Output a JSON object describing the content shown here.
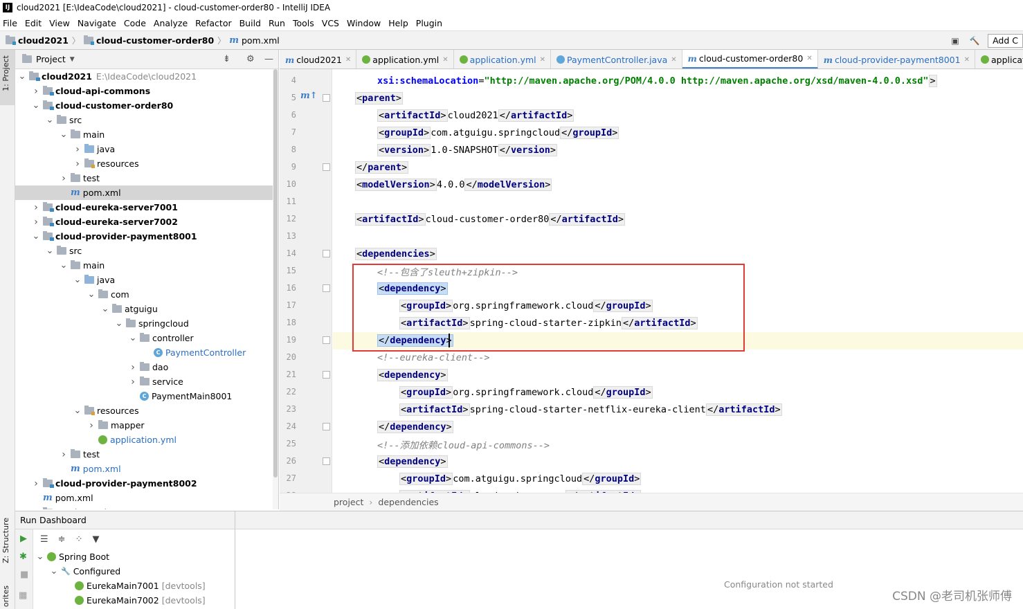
{
  "window": {
    "title": "cloud2021 [E:\\IdeaCode\\cloud2021] - cloud-customer-order80 - IntelliJ IDEA",
    "logo": "IJ"
  },
  "menu": [
    "File",
    "Edit",
    "View",
    "Navigate",
    "Code",
    "Analyze",
    "Refactor",
    "Build",
    "Run",
    "Tools",
    "VCS",
    "Window",
    "Help",
    "Plugin"
  ],
  "navbar": {
    "crumbs": [
      "cloud2021",
      "cloud-customer-order80",
      "pom.xml"
    ],
    "add_label": "Add C"
  },
  "left_stripe": {
    "project_tab": "1: Project",
    "structure_tab": "Z: Structure",
    "favorites_tab": "orites"
  },
  "project_panel": {
    "title": "Project",
    "tree": [
      {
        "label": "cloud2021",
        "extra": "E:\\IdeaCode\\cloud2021",
        "bold": true,
        "depth": 0,
        "arrow": "down",
        "icon": "module"
      },
      {
        "label": "cloud-api-commons",
        "bold": true,
        "depth": 1,
        "arrow": "right",
        "icon": "module"
      },
      {
        "label": "cloud-customer-order80",
        "bold": true,
        "depth": 1,
        "arrow": "down",
        "icon": "module"
      },
      {
        "label": "src",
        "depth": 2,
        "arrow": "down",
        "icon": "folder"
      },
      {
        "label": "main",
        "depth": 3,
        "arrow": "down",
        "icon": "folder"
      },
      {
        "label": "java",
        "depth": 4,
        "arrow": "right",
        "icon": "src"
      },
      {
        "label": "resources",
        "depth": 4,
        "arrow": "right",
        "icon": "res"
      },
      {
        "label": "test",
        "depth": 3,
        "arrow": "right",
        "icon": "folder"
      },
      {
        "label": "pom.xml",
        "depth": 3,
        "arrow": "none",
        "icon": "maven",
        "selected": true
      },
      {
        "label": "cloud-eureka-server7001",
        "bold": true,
        "depth": 1,
        "arrow": "right",
        "icon": "module"
      },
      {
        "label": "cloud-eureka-server7002",
        "bold": true,
        "depth": 1,
        "arrow": "right",
        "icon": "module"
      },
      {
        "label": "cloud-provider-payment8001",
        "bold": true,
        "depth": 1,
        "arrow": "down",
        "icon": "module"
      },
      {
        "label": "src",
        "depth": 2,
        "arrow": "down",
        "icon": "folder"
      },
      {
        "label": "main",
        "depth": 3,
        "arrow": "down",
        "icon": "folder"
      },
      {
        "label": "java",
        "depth": 4,
        "arrow": "down",
        "icon": "src"
      },
      {
        "label": "com",
        "depth": 5,
        "arrow": "down",
        "icon": "folder"
      },
      {
        "label": "atguigu",
        "depth": 6,
        "arrow": "down",
        "icon": "folder"
      },
      {
        "label": "springcloud",
        "depth": 7,
        "arrow": "down",
        "icon": "folder"
      },
      {
        "label": "controller",
        "depth": 8,
        "arrow": "down",
        "icon": "folder"
      },
      {
        "label": "PaymentController",
        "depth": 9,
        "arrow": "none",
        "icon": "class",
        "blue": true
      },
      {
        "label": "dao",
        "depth": 8,
        "arrow": "right",
        "icon": "folder"
      },
      {
        "label": "service",
        "depth": 8,
        "arrow": "right",
        "icon": "folder"
      },
      {
        "label": "PaymentMain8001",
        "depth": 8,
        "arrow": "none",
        "icon": "class"
      },
      {
        "label": "resources",
        "depth": 4,
        "arrow": "down",
        "icon": "res"
      },
      {
        "label": "mapper",
        "depth": 5,
        "arrow": "right",
        "icon": "folder"
      },
      {
        "label": "application.yml",
        "depth": 5,
        "arrow": "none",
        "icon": "spring",
        "blue": true
      },
      {
        "label": "test",
        "depth": 3,
        "arrow": "right",
        "icon": "folder"
      },
      {
        "label": "pom.xml",
        "depth": 3,
        "arrow": "none",
        "icon": "maven",
        "blue": true
      },
      {
        "label": "cloud-provider-payment8002",
        "bold": true,
        "depth": 1,
        "arrow": "right",
        "icon": "module"
      },
      {
        "label": "pom.xml",
        "depth": 1,
        "arrow": "none",
        "icon": "maven"
      },
      {
        "label": "ReadMe.md",
        "depth": 1,
        "arrow": "none",
        "icon": "file"
      }
    ]
  },
  "tabs": [
    {
      "label": "cloud2021",
      "icon": "maven"
    },
    {
      "label": "application.yml",
      "icon": "spring"
    },
    {
      "label": "application.yml",
      "icon": "spring",
      "blue": true
    },
    {
      "label": "PaymentController.java",
      "icon": "class",
      "blue": true
    },
    {
      "label": "cloud-customer-order80",
      "icon": "maven",
      "active": true
    },
    {
      "label": "cloud-provider-payment8001",
      "icon": "maven",
      "blue": true
    },
    {
      "label": "application.yml",
      "icon": "spring"
    }
  ],
  "editor": {
    "lines": [
      {
        "n": "4",
        "indent": 2,
        "parts": [
          [
            "attrn",
            "xsi:schemaLocation"
          ],
          [
            "txt",
            "="
          ],
          [
            "attrv",
            "\"http://maven.apache.org/POM/4.0.0 http://maven.apache.org/xsd/maven-4.0.0.xsd\""
          ],
          [
            "tc",
            ">"
          ]
        ]
      },
      {
        "n": "5",
        "indent": 1,
        "parts": [
          [
            "open",
            "parent"
          ]
        ]
      },
      {
        "n": "6",
        "indent": 2,
        "parts": [
          [
            "open",
            "artifactId"
          ],
          [
            "txt",
            "cloud2021"
          ],
          [
            "close",
            "artifactId"
          ]
        ]
      },
      {
        "n": "7",
        "indent": 2,
        "parts": [
          [
            "open",
            "groupId"
          ],
          [
            "txt",
            "com.atguigu.springcloud"
          ],
          [
            "close",
            "groupId"
          ]
        ]
      },
      {
        "n": "8",
        "indent": 2,
        "parts": [
          [
            "open",
            "version"
          ],
          [
            "txt",
            "1.0-SNAPSHOT"
          ],
          [
            "close",
            "version"
          ]
        ]
      },
      {
        "n": "9",
        "indent": 1,
        "parts": [
          [
            "close",
            "parent"
          ]
        ]
      },
      {
        "n": "10",
        "indent": 1,
        "parts": [
          [
            "open",
            "modelVersion"
          ],
          [
            "txt",
            "4.0.0"
          ],
          [
            "close",
            "modelVersion"
          ]
        ]
      },
      {
        "n": "11",
        "indent": 1,
        "parts": []
      },
      {
        "n": "12",
        "indent": 1,
        "parts": [
          [
            "open",
            "artifactId"
          ],
          [
            "txt",
            "cloud-customer-order80"
          ],
          [
            "close",
            "artifactId"
          ]
        ]
      },
      {
        "n": "13",
        "indent": 1,
        "parts": []
      },
      {
        "n": "14",
        "indent": 1,
        "parts": [
          [
            "open",
            "dependencies"
          ]
        ]
      },
      {
        "n": "15",
        "indent": 2,
        "parts": [
          [
            "cm",
            "<!--包含了sleuth+zipkin-->"
          ]
        ]
      },
      {
        "n": "16",
        "indent": 2,
        "parts": [
          [
            "openhl",
            "dependency"
          ]
        ]
      },
      {
        "n": "17",
        "indent": 3,
        "parts": [
          [
            "open",
            "groupId"
          ],
          [
            "txt",
            "org.springframework.cloud"
          ],
          [
            "close",
            "groupId"
          ]
        ]
      },
      {
        "n": "18",
        "indent": 3,
        "parts": [
          [
            "open",
            "artifactId"
          ],
          [
            "txt",
            "spring-cloud-starter-zipkin"
          ],
          [
            "close",
            "artifactId"
          ]
        ]
      },
      {
        "n": "19",
        "indent": 2,
        "parts": [
          [
            "closehl",
            "dependency"
          ]
        ]
      },
      {
        "n": "20",
        "indent": 2,
        "parts": [
          [
            "cm",
            "<!--eureka-client-->"
          ]
        ]
      },
      {
        "n": "21",
        "indent": 2,
        "parts": [
          [
            "open",
            "dependency"
          ]
        ]
      },
      {
        "n": "22",
        "indent": 3,
        "parts": [
          [
            "open",
            "groupId"
          ],
          [
            "txt",
            "org.springframework.cloud"
          ],
          [
            "close",
            "groupId"
          ]
        ]
      },
      {
        "n": "23",
        "indent": 3,
        "parts": [
          [
            "open",
            "artifactId"
          ],
          [
            "txt",
            "spring-cloud-starter-netflix-eureka-client"
          ],
          [
            "close",
            "artifactId"
          ]
        ]
      },
      {
        "n": "24",
        "indent": 2,
        "parts": [
          [
            "close",
            "dependency"
          ]
        ]
      },
      {
        "n": "25",
        "indent": 2,
        "parts": [
          [
            "cm",
            "<!--添加依赖cloud-api-commons-->"
          ]
        ]
      },
      {
        "n": "26",
        "indent": 2,
        "parts": [
          [
            "open",
            "dependency"
          ]
        ]
      },
      {
        "n": "27",
        "indent": 3,
        "parts": [
          [
            "open",
            "groupId"
          ],
          [
            "txt",
            "com.atguigu.springcloud"
          ],
          [
            "close",
            "groupId"
          ]
        ]
      },
      {
        "n": "28",
        "indent": 3,
        "parts": [
          [
            "open",
            "artifactId"
          ],
          [
            "txt",
            "cloud-api-commons"
          ],
          [
            "close",
            "artifactId"
          ]
        ]
      }
    ]
  },
  "editor_breadcrumb": [
    "project",
    "dependencies"
  ],
  "run_dashboard": {
    "title": "Run Dashboard",
    "tree": [
      {
        "label": "Spring Boot",
        "depth": 0,
        "arrow": "down",
        "icon": "spring"
      },
      {
        "label": "Configured",
        "depth": 1,
        "arrow": "down",
        "icon": "wrench"
      },
      {
        "label": "EurekaMain7001",
        "extra": "[devtools]",
        "depth": 2,
        "arrow": "none",
        "icon": "spring"
      },
      {
        "label": "EurekaMain7002",
        "extra": "[devtools]",
        "depth": 2,
        "arrow": "none",
        "icon": "spring"
      }
    ],
    "message": "Configuration not started"
  },
  "watermark": "CSDN @老司机张师傅",
  "colors": {
    "accent": "#4083c9",
    "highlight_box": "#e53935",
    "tag_name": "#000080",
    "attr_value": "#008000"
  }
}
